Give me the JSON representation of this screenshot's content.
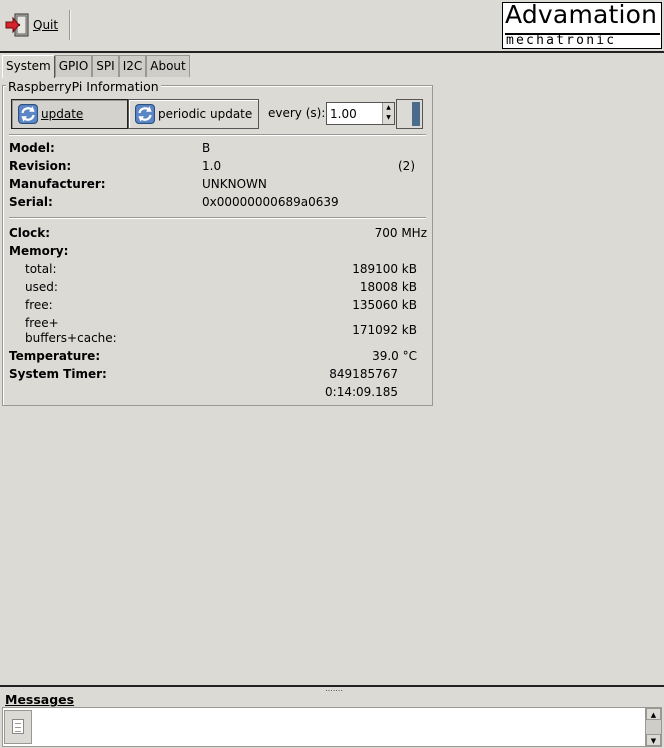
{
  "toolbar": {
    "quit_label": "Quit"
  },
  "logo": {
    "line1": "Advamation",
    "line2": "mechatronic"
  },
  "tabs": [
    {
      "label": "System",
      "active": true
    },
    {
      "label": "GPIO"
    },
    {
      "label": "SPI"
    },
    {
      "label": "I2C"
    },
    {
      "label": "About"
    }
  ],
  "frame": {
    "title": "RaspberryPi Information"
  },
  "controls": {
    "update_label": "update",
    "periodic_label": "periodic update",
    "every_label": "every (s):",
    "interval_value": "1.00"
  },
  "info": {
    "model_label": "Model:",
    "model_value": "B",
    "revision_label": "Revision:",
    "revision_value": "1.0",
    "revision_code": "(2)",
    "manufacturer_label": "Manufacturer:",
    "manufacturer_value": "UNKNOWN",
    "serial_label": "Serial:",
    "serial_value": "0x00000000689a0639"
  },
  "stats": {
    "clock_label": "Clock:",
    "clock_value": "700 MHz",
    "memory_label": "Memory:",
    "total_label": "total:",
    "total_value": "189100 kB",
    "used_label": "used:",
    "used_value": "18008 kB",
    "free_label": "free:",
    "free_value": "135060 kB",
    "freebuf_label1": "free+",
    "freebuf_label2": "buffers+cache:",
    "freebuf_value": "171092 kB",
    "temp_label": "Temperature:",
    "temp_value": "39.0 °C",
    "timer_label": "System Timer:",
    "timer_value1": "849185767",
    "timer_value2": "0:14:09.185"
  },
  "messages": {
    "title": "Messages",
    "grip": ",,,,,,,"
  },
  "colors": {
    "background": "#dcdad5",
    "toggle_accent": "#4a6a8e"
  }
}
